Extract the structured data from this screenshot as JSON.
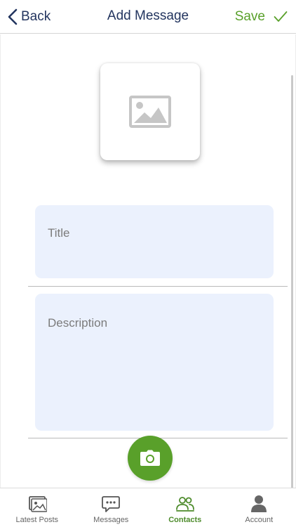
{
  "header": {
    "back_label": "Back",
    "title": "Add Message",
    "save_label": "Save"
  },
  "form": {
    "title_placeholder": "Title",
    "description_placeholder": "Description"
  },
  "tabs": [
    {
      "label": "Latest Posts",
      "icon": "gallery-icon",
      "active": false
    },
    {
      "label": "Messages",
      "icon": "chat-icon",
      "active": false
    },
    {
      "label": "Contacts",
      "icon": "contacts-icon",
      "active": true
    },
    {
      "label": "Account",
      "icon": "person-icon",
      "active": false
    }
  ],
  "colors": {
    "primary_navy": "#23355f",
    "accent_green": "#59a02a",
    "field_background": "#ebf1fd"
  }
}
